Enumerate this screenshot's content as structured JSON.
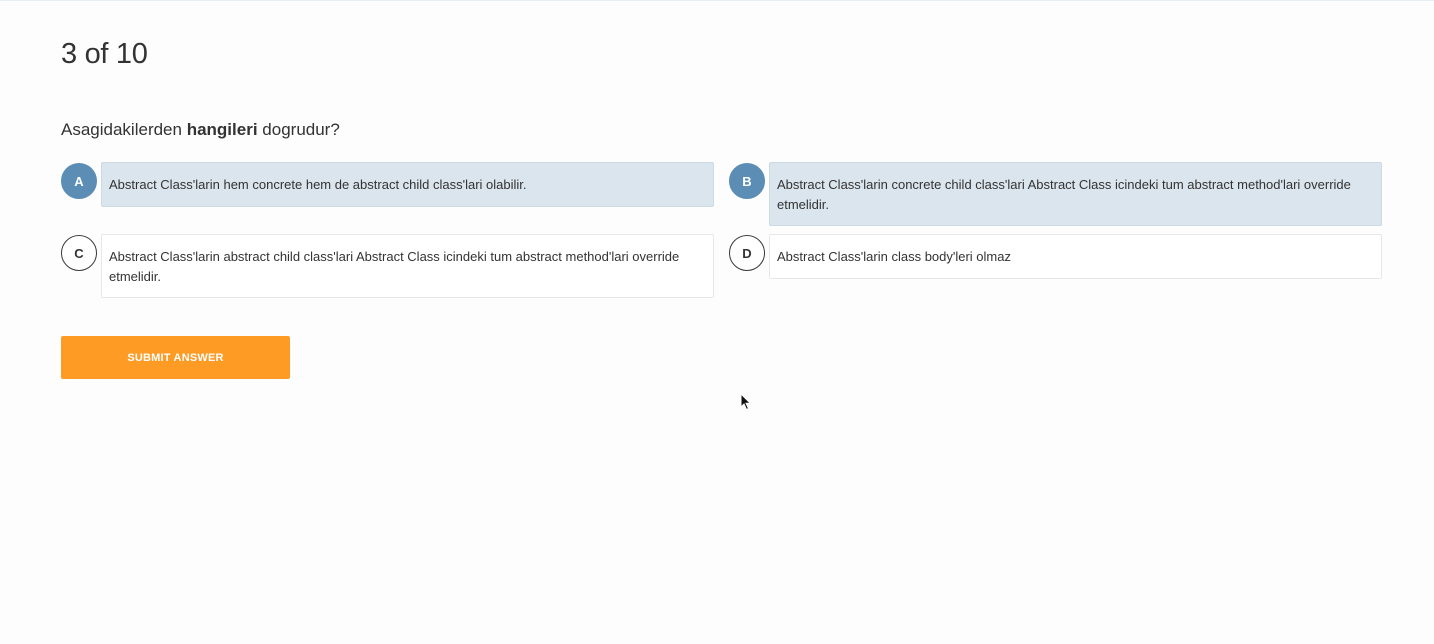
{
  "progress": {
    "text": "3 of 10"
  },
  "question": {
    "prefix": "Asagidakilerden",
    "bold": "hangileri",
    "suffix": "dogrudur?"
  },
  "options": [
    {
      "letter": "A",
      "text": "Abstract Class'larin hem concrete hem de abstract child class'lari olabilir.",
      "selected": true
    },
    {
      "letter": "B",
      "text": "Abstract Class'larin concrete child class'lari Abstract Class icindeki tum abstract method'lari override etmelidir.",
      "selected": true
    },
    {
      "letter": "C",
      "text": "Abstract Class'larin abstract child class'lari Abstract Class icindeki tum abstract method'lari override etmelidir.",
      "selected": false
    },
    {
      "letter": "D",
      "text": "Abstract Class'larin class body'leri olmaz",
      "selected": false
    }
  ],
  "submit": {
    "label": "SUBMIT ANSWER"
  },
  "colors": {
    "accent_orange": "#fd9b24",
    "selected_badge": "#5b8db5",
    "selected_box": "#dbe5ee"
  }
}
